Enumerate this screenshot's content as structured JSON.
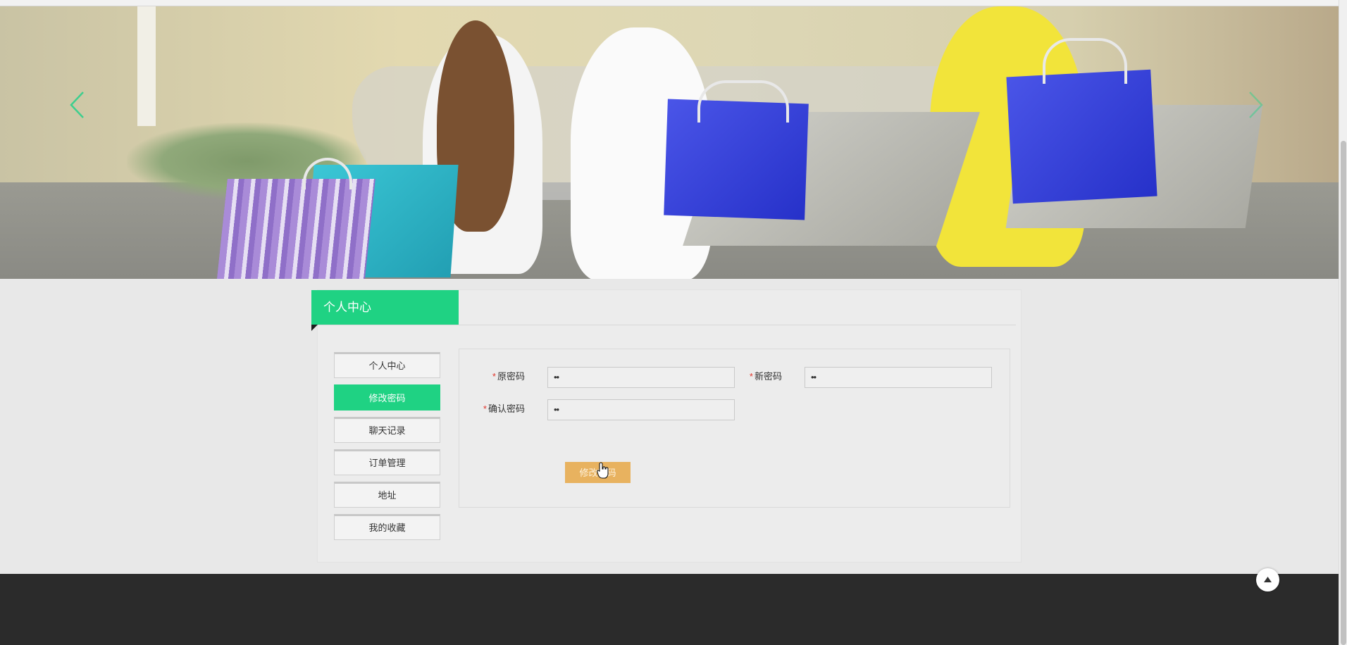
{
  "banner": {
    "prev_icon": "chevron-left-icon",
    "next_icon": "chevron-right-icon",
    "accent_color": "#3ecf8e"
  },
  "panel": {
    "title": "个人中心",
    "accent_color": "#1fd283"
  },
  "sidebar": {
    "items": [
      {
        "label": "个人中心",
        "active": false
      },
      {
        "label": "修改密码",
        "active": true
      },
      {
        "label": "聊天记录",
        "active": false
      },
      {
        "label": "订单管理",
        "active": false
      },
      {
        "label": "地址",
        "active": false
      },
      {
        "label": "我的收藏",
        "active": false
      }
    ]
  },
  "form": {
    "old_password": {
      "label": "原密码",
      "required_mark": "*",
      "value": "••"
    },
    "new_password": {
      "label": "新密码",
      "required_mark": "*",
      "value": "••"
    },
    "confirm_password": {
      "label": "确认密码",
      "required_mark": "*",
      "value": "••"
    },
    "submit_label": "修改密码",
    "submit_color": "#e8b25f"
  },
  "footer": {
    "back_to_top_icon": "arrow-up-icon"
  }
}
